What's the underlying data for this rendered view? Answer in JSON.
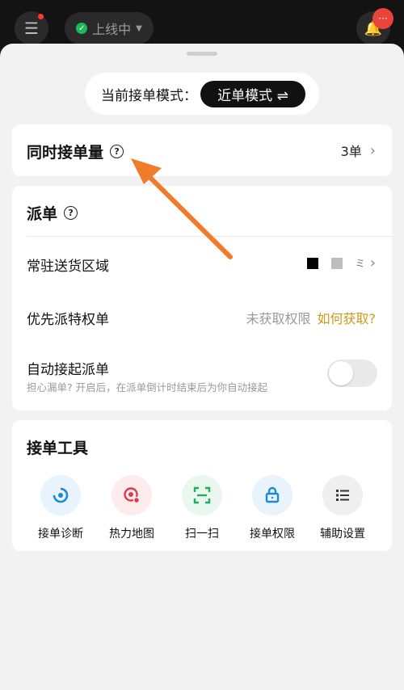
{
  "topbar": {
    "menu_icon": "menu-icon",
    "online_status": "上线中",
    "bell_badge": "···",
    "accent_online": "#1fb85a",
    "badge_color": "#e8443c"
  },
  "mode": {
    "label": "当前接单模式：",
    "value": "近单模式 ⇌"
  },
  "concurrent": {
    "title": "同时接单量",
    "value": "3单"
  },
  "dispatch": {
    "title": "派单",
    "area_label": "常驻送货区域",
    "area_value_tail": "ミ",
    "priority_label": "优先派特权单",
    "priority_status": "未获取权限",
    "priority_link": "如何获取?",
    "auto_label": "自动接起派单",
    "auto_desc": "担心漏单? 开启后，在派单倒计时结束后为你自动接起",
    "auto_enabled": false,
    "link_color": "#c99b1d"
  },
  "tools": {
    "title": "接单工具",
    "items": [
      {
        "label": "接单诊断",
        "icon": "diagnosis-icon",
        "bg": "#e8f3fb",
        "fg": "#1a8ad8"
      },
      {
        "label": "热力地图",
        "icon": "heatmap-icon",
        "bg": "#fdecee",
        "fg": "#e0394b"
      },
      {
        "label": "扫一扫",
        "icon": "scan-icon",
        "bg": "#e9f7ee",
        "fg": "#1fae5b"
      },
      {
        "label": "接单权限",
        "icon": "lock-icon",
        "bg": "#e8f3fb",
        "fg": "#1a8ad8"
      },
      {
        "label": "辅助设置",
        "icon": "list-settings-icon",
        "bg": "#efefef",
        "fg": "#333"
      }
    ]
  }
}
